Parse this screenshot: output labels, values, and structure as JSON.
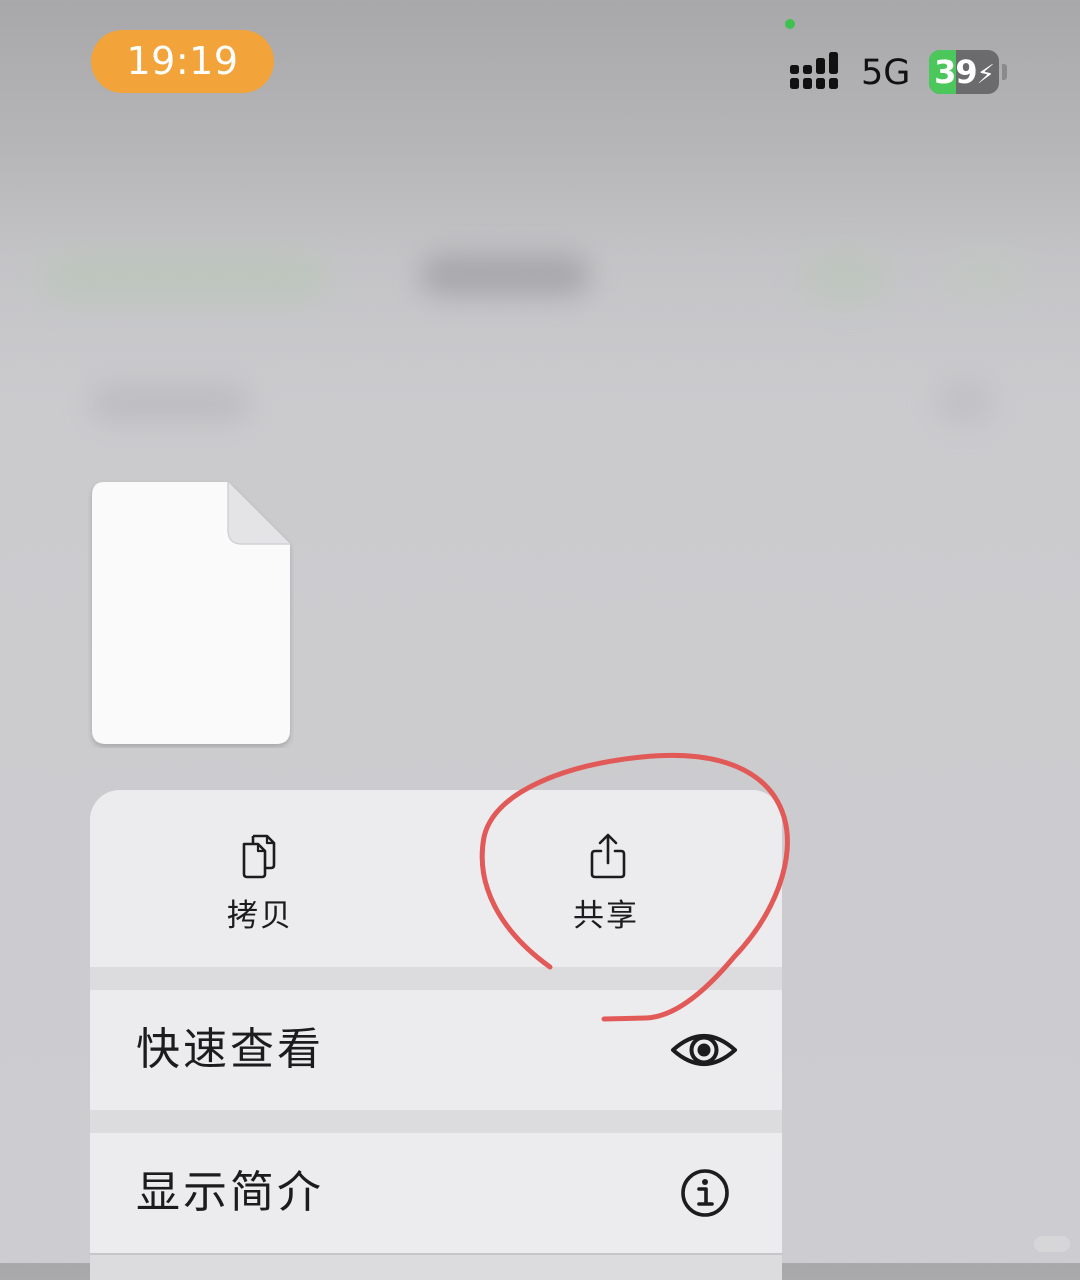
{
  "status_bar": {
    "time": "19:19",
    "network": "5G",
    "battery_level": "39",
    "battery_fraction": 0.39,
    "signal_icon": "cellular-signal-icon",
    "battery_icon": "battery-charging-icon"
  },
  "file_preview": {
    "icon": "blank-document-icon"
  },
  "context_menu": {
    "actions": [
      {
        "label": "拷贝",
        "icon": "copy-icon"
      },
      {
        "label": "共享",
        "icon": "share-icon"
      }
    ],
    "items": [
      {
        "label": "快速查看",
        "icon": "eye-icon"
      },
      {
        "label": "显示简介",
        "icon": "info-icon"
      }
    ]
  },
  "colors": {
    "time_pill": "#f2a33a",
    "battery_green": "#4cc75c",
    "annotation_red": "#e25a58",
    "menu_background": "#ececef"
  }
}
